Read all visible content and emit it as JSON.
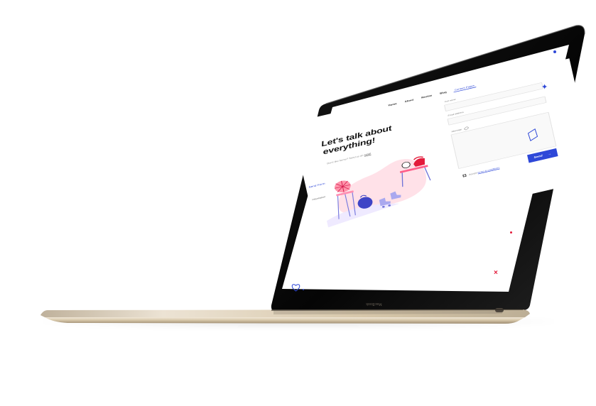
{
  "scene": {
    "device": "laptop",
    "bezel_brand": "MacBook"
  },
  "site": {
    "nav": [
      {
        "label": "Home"
      },
      {
        "label": "About"
      },
      {
        "label": "Review"
      },
      {
        "label": "Blog"
      },
      {
        "label": "Contact Pages"
      }
    ],
    "hero": {
      "title_line1": "Let's talk about",
      "title_line2": "everything!",
      "subtitle": "Don't like forms? Send us an",
      "subtitle_link": "email"
    },
    "left_hint": "Send Form",
    "left_hint_2": "Information",
    "form": {
      "fullname_label": "Full name",
      "fullname_placeholder": "",
      "email_label": "Email address",
      "email_placeholder": "",
      "message_label": "Message",
      "message_placeholder": "",
      "consent_prefix": "Accept",
      "consent_link": "terms & conditions",
      "send_label": "Send",
      "send_arrow": "→"
    }
  },
  "colors": {
    "accent": "#2e48d8",
    "accent_red": "#e31b3b",
    "laptop_gold": "#d8c8aa",
    "screen_black": "#080808"
  },
  "icons": {
    "send": "arrow-right-icon",
    "message": "paperclip-icon",
    "heart": "heart-icon",
    "deco_star": "star-icon",
    "deco_diamond": "diamond-icon",
    "deco_x": "x-icon"
  }
}
